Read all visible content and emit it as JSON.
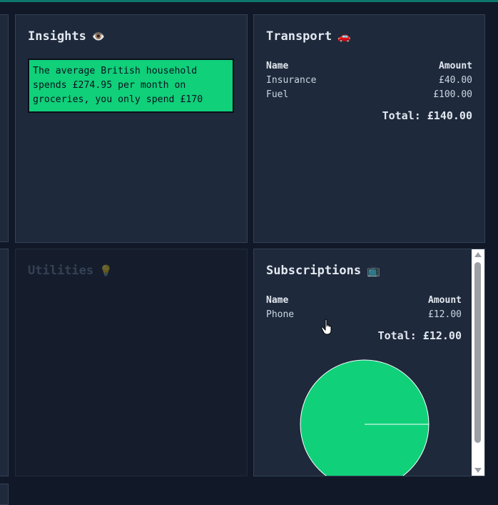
{
  "insights": {
    "title": "Insights",
    "icon": "eye-icon",
    "message": "The average British household spends £274.95 per month on groceries, you only spend £170"
  },
  "transport": {
    "title": "Transport",
    "icon": "car-icon",
    "columns": [
      "Name",
      "Amount"
    ],
    "rows": [
      {
        "name": "Insurance",
        "amount": "£40.00"
      },
      {
        "name": "Fuel",
        "amount": "£100.00"
      }
    ],
    "total": "Total: £140.00"
  },
  "utilities": {
    "title": "Utilities",
    "icon": "lightbulb-icon"
  },
  "subscriptions": {
    "title": "Subscriptions",
    "icon": "tv-icon",
    "columns": [
      "Name",
      "Amount"
    ],
    "rows": [
      {
        "name": "Phone",
        "amount": "£12.00"
      }
    ],
    "total": "Total: £12.00"
  },
  "chart_data": {
    "type": "pie",
    "categories": [
      "Phone"
    ],
    "values": [
      12.0
    ]
  },
  "colors": {
    "accent": "#10d07a",
    "background": "#111827",
    "card": "#1e293b",
    "border": "#334155"
  }
}
